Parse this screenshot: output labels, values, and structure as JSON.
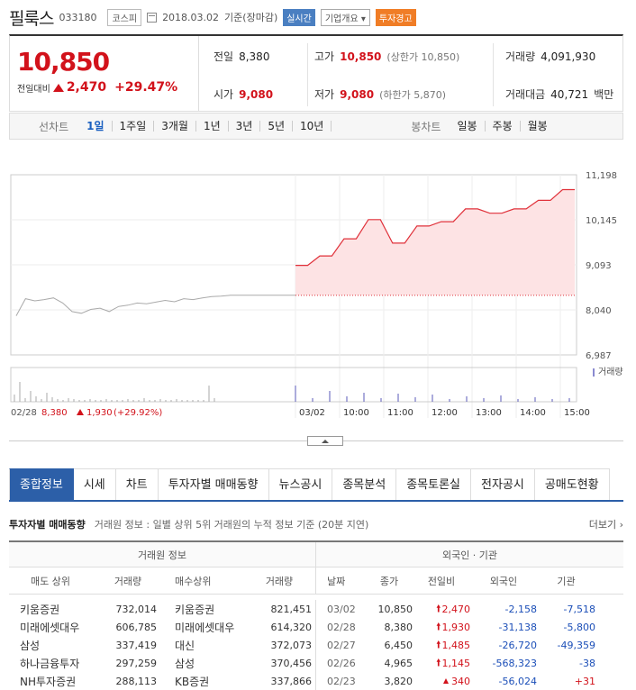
{
  "header": {
    "name": "필룩스",
    "code": "033180",
    "market": "코스피",
    "date": "2018.03.02",
    "date_suffix": "기준(장마감)",
    "realtime": "실시간",
    "company_overview": "기업개요",
    "invest_warning": "투자경고"
  },
  "summary": {
    "price": "10,850",
    "change_label": "전일대비",
    "change": "2,470",
    "change_pct": "+29.47%",
    "prev_close_label": "전일",
    "prev_close": "8,380",
    "high_label": "고가",
    "high": "10,850",
    "upper_limit": "(상한가 10,850)",
    "volume_label": "거래량",
    "volume": "4,091,930",
    "open_label": "시가",
    "open": "9,080",
    "low_label": "저가",
    "low": "9,080",
    "lower_limit": "(하한가 5,870)",
    "amount_label": "거래대금",
    "amount": "40,721",
    "amount_unit": "백만"
  },
  "period_bar": {
    "line_label": "선차트",
    "line_options": [
      "1일",
      "1주일",
      "3개월",
      "1년",
      "3년",
      "5년",
      "10년"
    ],
    "candle_label": "봉차트",
    "candle_options": [
      "일봉",
      "주봉",
      "월봉"
    ]
  },
  "chart_data": {
    "type": "line",
    "y_ticks": [
      "11,198",
      "10,145",
      "9,093",
      "8,040",
      "6,987"
    ],
    "ylim": [
      6987,
      11198
    ],
    "prev_close": 8380,
    "volume_label": "거래량",
    "x_labels": [
      "03/02",
      "10:00",
      "11:00",
      "12:00",
      "13:00",
      "14:00",
      "15:00"
    ],
    "prev_day_label": "02/28",
    "prev_day_price": "8,380",
    "prev_day_change": "1,930",
    "prev_day_pct": "(+29.92%)",
    "prev_day_series": [
      7900,
      8300,
      8250,
      8280,
      8320,
      8200,
      8000,
      7960,
      8050,
      8080,
      8000,
      8120,
      8150,
      8200,
      8180,
      8220,
      8260,
      8230,
      8300,
      8280,
      8320,
      8350,
      8360,
      8380,
      8380,
      8380,
      8380,
      8380,
      8380,
      8380,
      8380
    ],
    "today_series": [
      9080,
      9080,
      9300,
      9300,
      9700,
      9700,
      10150,
      10150,
      9600,
      9600,
      10000,
      10000,
      10100,
      10100,
      10400,
      10400,
      10300,
      10300,
      10400,
      10400,
      10600,
      10600,
      10850,
      10850
    ]
  },
  "tabs": [
    "종합정보",
    "시세",
    "차트",
    "투자자별 매매동향",
    "뉴스공시",
    "종목분석",
    "종목토론실",
    "전자공시",
    "공매도현황"
  ],
  "section": {
    "title": "투자자별 매매동향",
    "desc": "거래원 정보 : 일별 상위 5위 거래원의 누적 정보 기준 (20분 지연)",
    "more": "더보기"
  },
  "table": {
    "group_left": "거래원 정보",
    "group_right": "외국인 · 기관",
    "cols": [
      "매도 상위",
      "거래량",
      "매수상위",
      "거래량",
      "날짜",
      "종가",
      "전일비",
      "외국인",
      "기관"
    ],
    "rows": [
      {
        "sell": "키움증권",
        "sell_vol": "732,014",
        "buy": "키움증권",
        "buy_vol": "821,451",
        "date": "03/02",
        "close": "10,850",
        "chg": "2,470",
        "foreign": "-2,158",
        "inst": "-7,518"
      },
      {
        "sell": "미래에셋대우",
        "sell_vol": "606,785",
        "buy": "미래에셋대우",
        "buy_vol": "614,320",
        "date": "02/28",
        "close": "8,380",
        "chg": "1,930",
        "foreign": "-31,138",
        "inst": "-5,800"
      },
      {
        "sell": "삼성",
        "sell_vol": "337,419",
        "buy": "대신",
        "buy_vol": "372,073",
        "date": "02/27",
        "close": "6,450",
        "chg": "1,485",
        "foreign": "-26,720",
        "inst": "-49,359"
      },
      {
        "sell": "하나금융투자",
        "sell_vol": "297,259",
        "buy": "삼성",
        "buy_vol": "370,456",
        "date": "02/26",
        "close": "4,965",
        "chg": "1,145",
        "foreign": "-568,323",
        "inst": "-38"
      },
      {
        "sell": "NH투자증권",
        "sell_vol": "288,113",
        "buy": "KB증권",
        "buy_vol": "337,866",
        "date": "02/23",
        "close": "3,820",
        "chg": "340",
        "foreign": "-56,024",
        "inst": "+31"
      }
    ]
  }
}
